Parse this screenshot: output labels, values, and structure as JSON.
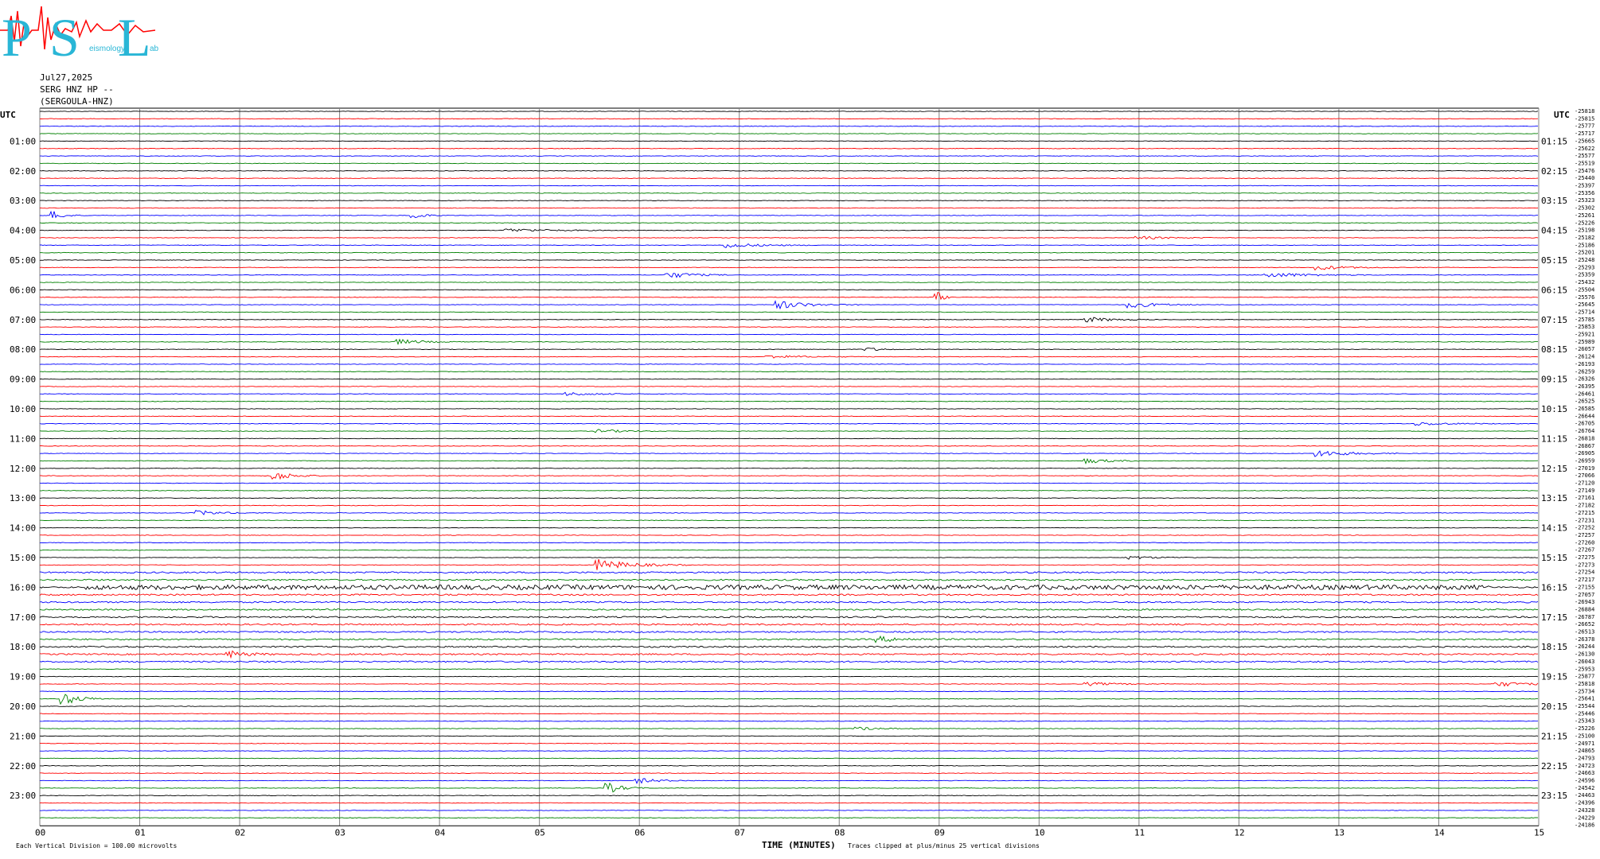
{
  "logo": {
    "letters": [
      "P",
      "S",
      "L"
    ],
    "small_text": [
      "eismology",
      "ab"
    ]
  },
  "header": {
    "date": "Jul27,2025",
    "station": "SERG HNZ HP --",
    "channel": "(SERGOULA-HNZ)"
  },
  "axis": {
    "left_title": "UTC",
    "right_title": "UTC",
    "x_title": "TIME (MINUTES)",
    "x_ticks": [
      "00",
      "01",
      "02",
      "03",
      "04",
      "05",
      "06",
      "07",
      "08",
      "09",
      "10",
      "11",
      "12",
      "13",
      "14",
      "15"
    ],
    "left_labels": [
      "01:00",
      "02:00",
      "03:00",
      "04:00",
      "05:00",
      "06:00",
      "07:00",
      "08:00",
      "09:00",
      "10:00",
      "11:00",
      "12:00",
      "13:00",
      "14:00",
      "15:00",
      "16:00",
      "17:00",
      "18:00",
      "19:00",
      "20:00",
      "21:00",
      "22:00",
      "23:00"
    ],
    "right_labels": [
      "01:15",
      "02:15",
      "03:15",
      "04:15",
      "05:15",
      "06:15",
      "07:15",
      "08:15",
      "09:15",
      "10:15",
      "11:15",
      "12:15",
      "13:15",
      "14:15",
      "15:15",
      "16:15",
      "17:15",
      "18:15",
      "19:15",
      "20:15",
      "21:15",
      "22:15",
      "23:15"
    ]
  },
  "footer": {
    "scale_note": "Each Vertical Division =  100.00 microvolts",
    "clip_note": "Traces clipped at plus/minus 25 vertical divisions"
  },
  "colors": {
    "trace_cycle": [
      "#000000",
      "#ff0000",
      "#0000ff",
      "#008000"
    ],
    "grid": "#808080",
    "logo": "#29b6d6",
    "logo_wave": "#ff0000"
  },
  "chart_data": {
    "type": "line",
    "title": "",
    "xlabel": "TIME (MINUTES)",
    "ylabel": "UTC",
    "xlim": [
      0,
      15
    ],
    "trace_count": 96,
    "minutes_per_trace": 15,
    "offsets": [
      "-25818",
      "-25815",
      "-25777",
      "-25717",
      "-25665",
      "-25622",
      "-25577",
      "-25519",
      "-25476",
      "-25440",
      "-25397",
      "-25356",
      "-25323",
      "-25302",
      "-25261",
      "-25226",
      "-25198",
      "-25182",
      "-25186",
      "-25201",
      "-25248",
      "-25293",
      "-25359",
      "-25432",
      "-25504",
      "-25576",
      "-25645",
      "-25714",
      "-25785",
      "-25853",
      "-25921",
      "-25989",
      "-26057",
      "-26124",
      "-26193",
      "-26259",
      "-26326",
      "-26395",
      "-26461",
      "-26525",
      "-26585",
      "-26644",
      "-26705",
      "-26764",
      "-26818",
      "-26867",
      "-26905",
      "-26959",
      "-27019",
      "-27066",
      "-27120",
      "-27149",
      "-27161",
      "-27182",
      "-27215",
      "-27231",
      "-27252",
      "-27257",
      "-27260",
      "-27267",
      "-27275",
      "-27273",
      "-27254",
      "-27217",
      "-27155",
      "-27057",
      "-26943",
      "-26884",
      "-26787",
      "-26652",
      "-26513",
      "-26378",
      "-26244",
      "-26130",
      "-26043",
      "-25953",
      "-25877",
      "-25818",
      "-25734",
      "-25641",
      "-25544",
      "-25446",
      "-25343",
      "-25226",
      "-25100",
      "-24971",
      "-24865",
      "-24793",
      "-24723",
      "-24663",
      "-24596",
      "-24542",
      "-24463",
      "-24396",
      "-24328",
      "-24229",
      "-24186"
    ],
    "events": [
      {
        "trace": 14,
        "minute": 0.15,
        "amp": 5,
        "dur": 0.3
      },
      {
        "trace": 14,
        "minute": 3.75,
        "amp": 4,
        "dur": 0.3
      },
      {
        "trace": 16,
        "minute": 4.7,
        "amp": 2,
        "dur": 1.2
      },
      {
        "trace": 17,
        "minute": 11.0,
        "amp": 2,
        "dur": 0.8
      },
      {
        "trace": 18,
        "minute": 6.9,
        "amp": 3,
        "dur": 0.9
      },
      {
        "trace": 21,
        "minute": 12.8,
        "amp": 3,
        "dur": 0.8
      },
      {
        "trace": 22,
        "minute": 6.3,
        "amp": 4,
        "dur": 0.7
      },
      {
        "trace": 22,
        "minute": 12.3,
        "amp": 3,
        "dur": 1.2
      },
      {
        "trace": 25,
        "minute": 9.0,
        "amp": 6,
        "dur": 0.15
      },
      {
        "trace": 26,
        "minute": 7.4,
        "amp": 5,
        "dur": 0.8
      },
      {
        "trace": 26,
        "minute": 10.9,
        "amp": 4,
        "dur": 0.8
      },
      {
        "trace": 28,
        "minute": 10.5,
        "amp": 3,
        "dur": 0.7
      },
      {
        "trace": 31,
        "minute": 3.6,
        "amp": 3,
        "dur": 0.7
      },
      {
        "trace": 32,
        "minute": 8.3,
        "amp": 2,
        "dur": 0.4
      },
      {
        "trace": 33,
        "minute": 7.3,
        "amp": 2,
        "dur": 1.0
      },
      {
        "trace": 38,
        "minute": 5.3,
        "amp": 2,
        "dur": 0.8
      },
      {
        "trace": 42,
        "minute": 13.8,
        "amp": 2,
        "dur": 1.0
      },
      {
        "trace": 43,
        "minute": 5.6,
        "amp": 2,
        "dur": 0.8
      },
      {
        "trace": 46,
        "minute": 12.8,
        "amp": 4,
        "dur": 0.9
      },
      {
        "trace": 47,
        "minute": 10.5,
        "amp": 3,
        "dur": 0.6
      },
      {
        "trace": 49,
        "minute": 2.35,
        "amp": 6,
        "dur": 0.5
      },
      {
        "trace": 54,
        "minute": 1.6,
        "amp": 3,
        "dur": 0.6
      },
      {
        "trace": 60,
        "minute": 10.9,
        "amp": 2,
        "dur": 0.8
      },
      {
        "trace": 61,
        "minute": 5.6,
        "amp": 7,
        "dur": 0.9
      },
      {
        "trace": 64,
        "minute": 0.5,
        "amp": 2,
        "dur": 14.0
      },
      {
        "trace": 71,
        "minute": 8.4,
        "amp": 3,
        "dur": 0.8
      },
      {
        "trace": 73,
        "minute": 1.9,
        "amp": 4,
        "dur": 0.5
      },
      {
        "trace": 77,
        "minute": 10.5,
        "amp": 2,
        "dur": 0.9
      },
      {
        "trace": 77,
        "minute": 14.6,
        "amp": 3,
        "dur": 0.8
      },
      {
        "trace": 79,
        "minute": 0.25,
        "amp": 7,
        "dur": 0.5
      },
      {
        "trace": 83,
        "minute": 8.2,
        "amp": 2,
        "dur": 0.6
      },
      {
        "trace": 90,
        "minute": 6.0,
        "amp": 3,
        "dur": 0.6
      },
      {
        "trace": 91,
        "minute": 5.7,
        "amp": 6,
        "dur": 0.4
      }
    ]
  }
}
